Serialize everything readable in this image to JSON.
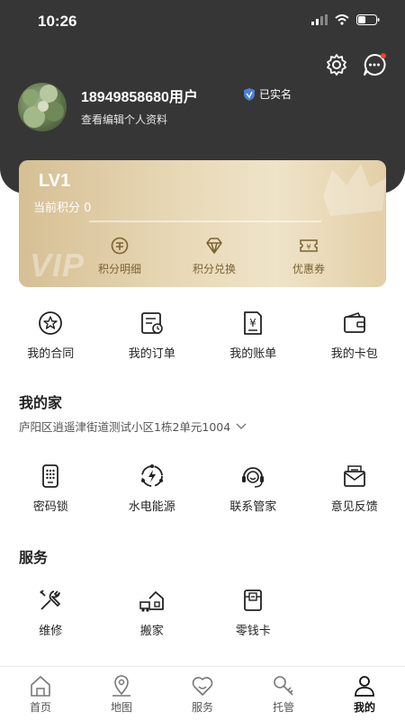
{
  "status": {
    "time": "10:26"
  },
  "profile": {
    "username": "18949858680用户",
    "verified_label": "已实名",
    "edit_label": "查看编辑个人资料"
  },
  "vip": {
    "level": "LV1",
    "points_label": "当前积分 0",
    "progress_fraction": 0,
    "watermark": "VIP",
    "actions": [
      {
        "label": "积分明细",
        "icon": "points-detail-icon"
      },
      {
        "label": "积分兑换",
        "icon": "diamond-icon"
      },
      {
        "label": "优惠券",
        "icon": "coupon-icon"
      }
    ]
  },
  "orders": [
    {
      "label": "我的合同",
      "icon": "contract-icon"
    },
    {
      "label": "我的订单",
      "icon": "order-icon"
    },
    {
      "label": "我的账单",
      "icon": "bill-icon"
    },
    {
      "label": "我的卡包",
      "icon": "wallet-icon"
    }
  ],
  "home": {
    "title": "我的家",
    "address": "庐阳区逍遥津街道测试小区1栋2单元1004",
    "items": [
      {
        "label": "密码锁",
        "icon": "keypad-lock-icon"
      },
      {
        "label": "水电能源",
        "icon": "energy-icon"
      },
      {
        "label": "联系管家",
        "icon": "headset-icon"
      },
      {
        "label": "意见反馈",
        "icon": "feedback-icon"
      }
    ]
  },
  "services": {
    "title": "服务",
    "items": [
      {
        "label": "维修",
        "icon": "repair-icon"
      },
      {
        "label": "搬家",
        "icon": "moving-icon"
      },
      {
        "label": "零钱卡",
        "icon": "change-card-icon"
      }
    ]
  },
  "tabs": [
    {
      "label": "首页",
      "icon": "home-icon"
    },
    {
      "label": "地图",
      "icon": "map-pin-icon"
    },
    {
      "label": "服务",
      "icon": "heart-icon"
    },
    {
      "label": "托管",
      "icon": "key-icon"
    },
    {
      "label": "我的",
      "icon": "profile-icon",
      "active": true
    }
  ],
  "colors": {
    "header": "#363636",
    "gold": "#7a6233",
    "badge": "#4a7fd4"
  }
}
